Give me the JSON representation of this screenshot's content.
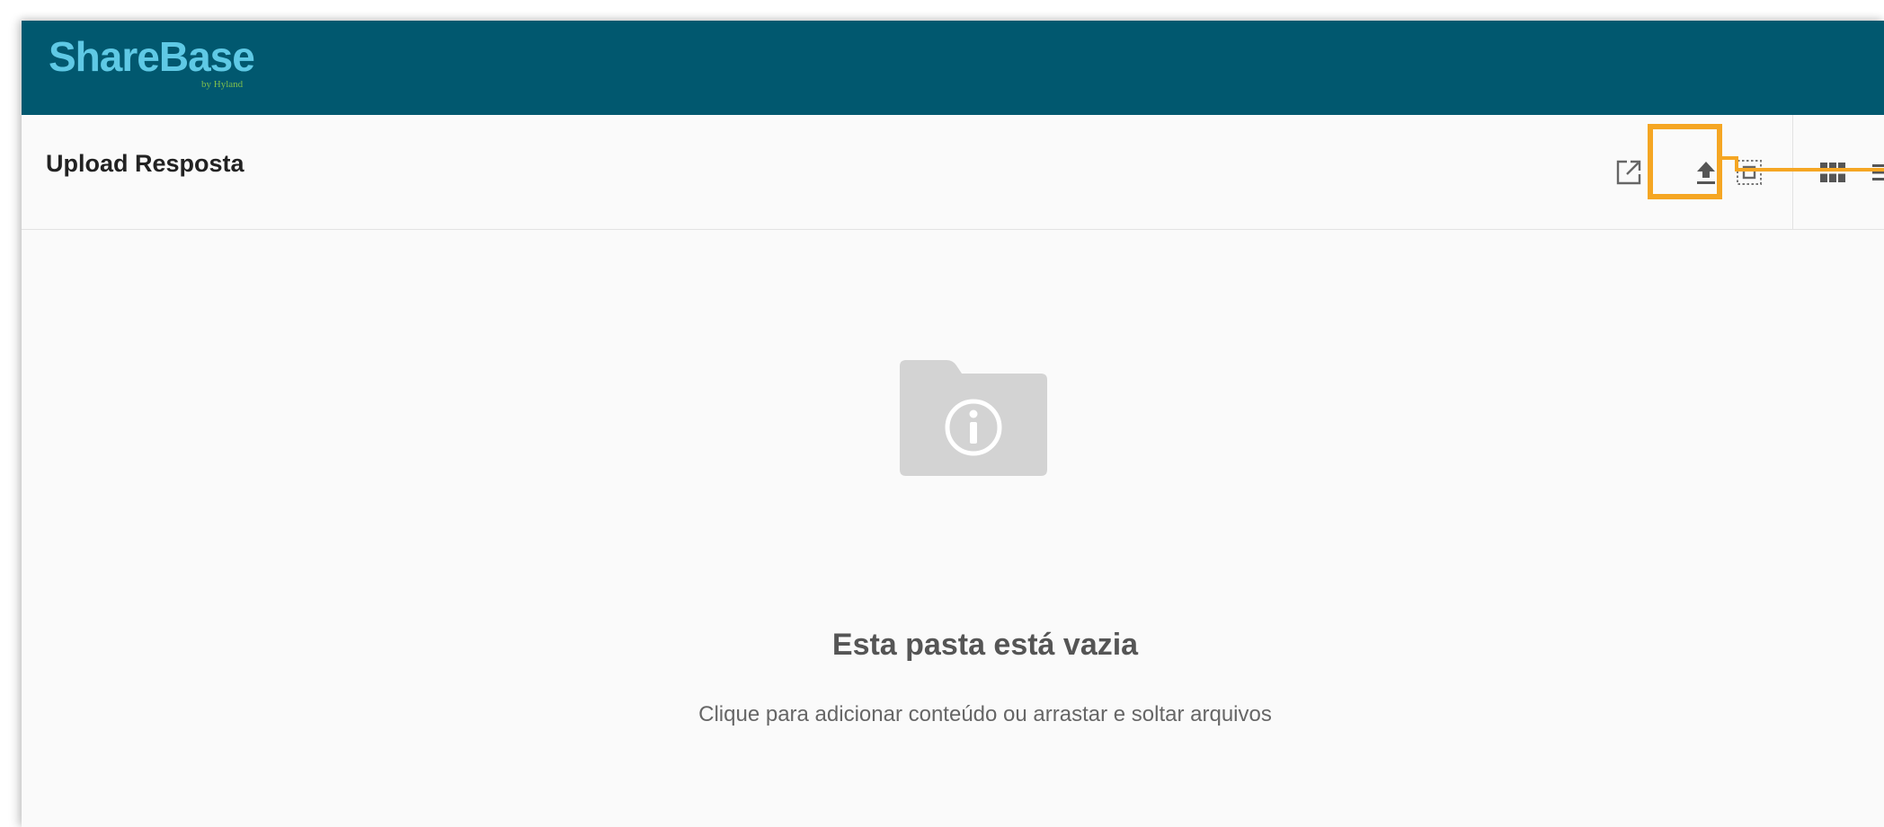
{
  "app": {
    "logo": "ShareBase",
    "logo_sub": "by Hyland"
  },
  "toolbar": {
    "title": "Upload Resposta",
    "icons": [
      "open-external-icon",
      "upload-icon",
      "select-box-icon",
      "grid-view-icon",
      "list-view-icon"
    ]
  },
  "empty_state": {
    "icon": "folder-info-icon",
    "title": "Esta pasta está vazia",
    "subtitle": "Clique para adicionar conteúdo ou arrastar e soltar arquivos"
  },
  "colors": {
    "header": "#01586f",
    "logo": "#5fc9e5",
    "highlight": "#f5a623",
    "empty_icon": "#d0d0d0"
  }
}
